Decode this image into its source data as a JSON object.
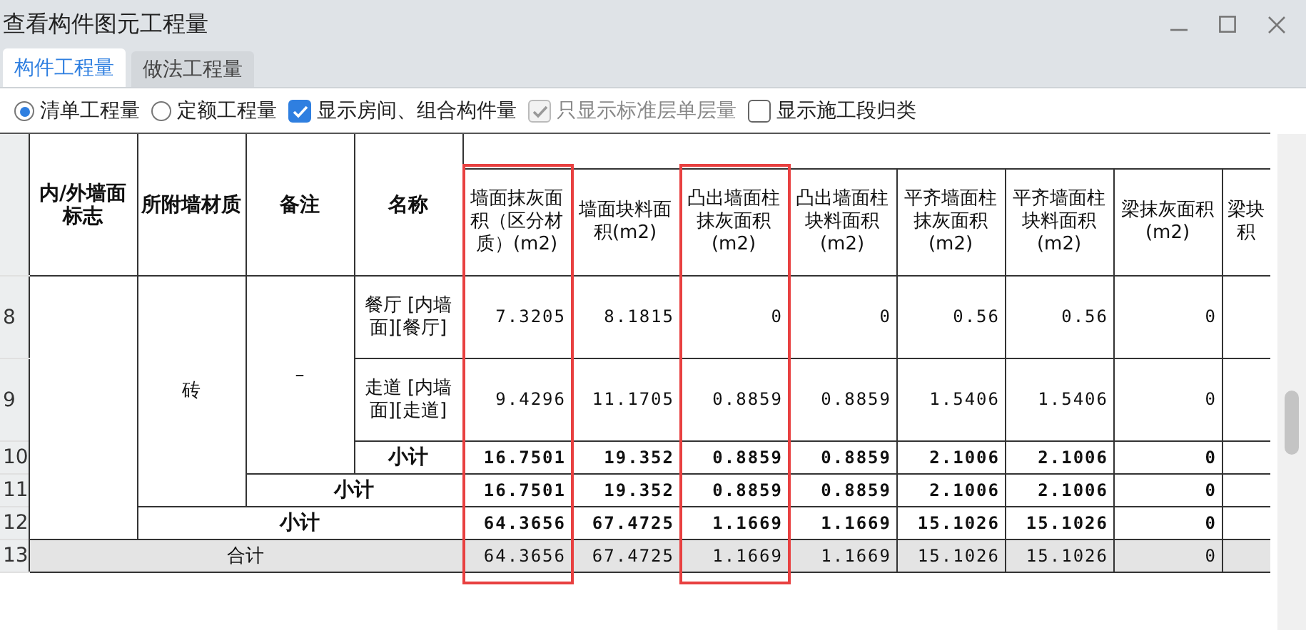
{
  "window": {
    "title": "查看构件图元工程量"
  },
  "tabs": [
    {
      "label": "构件工程量",
      "selected": true
    },
    {
      "label": "做法工程量",
      "selected": false
    }
  ],
  "options": [
    {
      "kind": "radio",
      "label": "清单工程量",
      "checked": true,
      "disabled": false
    },
    {
      "kind": "radio",
      "label": "定额工程量",
      "checked": false,
      "disabled": false
    },
    {
      "kind": "checkbox",
      "label": "显示房间、组合构件量",
      "checked": true,
      "disabled": false
    },
    {
      "kind": "checkbox",
      "label": "只显示标准层单层量",
      "checked": true,
      "disabled": true
    },
    {
      "kind": "checkbox",
      "label": "显示施工段归类",
      "checked": false,
      "disabled": false
    }
  ],
  "table": {
    "group_columns": [
      "内/外墙面标志",
      "所附墙材质",
      "备注",
      "名称"
    ],
    "quantity_columns": [
      {
        "label": "墙面抹灰面积（区分材质）(m2)",
        "highlighted": true
      },
      {
        "label": "墙面块料面积(m2)",
        "highlighted": false
      },
      {
        "label": "凸出墙面柱抹灰面积(m2)",
        "highlighted": true
      },
      {
        "label": "凸出墙面柱块料面积(m2)",
        "highlighted": false
      },
      {
        "label": "平齐墙面柱抹灰面积(m2)",
        "highlighted": false
      },
      {
        "label": "平齐墙面柱块料面积(m2)",
        "highlighted": false
      },
      {
        "label": "梁抹灰面积(m2)",
        "highlighted": false
      },
      {
        "label": "梁块积",
        "highlighted": false
      }
    ],
    "material": "砖",
    "remark": "–",
    "rows": [
      {
        "number": "8",
        "kind": "item",
        "name": "餐厅 [内墙面][餐厅]",
        "values": [
          "7.3205",
          "8.1815",
          "0",
          "0",
          "0.56",
          "0.56",
          "0"
        ]
      },
      {
        "number": "9",
        "kind": "item",
        "name": "走道 [内墙面][走道]",
        "values": [
          "9.4296",
          "11.1705",
          "0.8859",
          "0.8859",
          "1.5406",
          "1.5406",
          "0"
        ]
      },
      {
        "number": "10",
        "kind": "name_subtotal",
        "name": "小计",
        "values": [
          "16.7501",
          "19.352",
          "0.8859",
          "0.8859",
          "2.1006",
          "2.1006",
          "0"
        ]
      },
      {
        "number": "11",
        "kind": "remark_subtotal",
        "name": "小计",
        "values": [
          "16.7501",
          "19.352",
          "0.8859",
          "0.8859",
          "2.1006",
          "2.1006",
          "0"
        ]
      },
      {
        "number": "12",
        "kind": "material_subtotal",
        "name": "小计",
        "values": [
          "64.3656",
          "67.4725",
          "1.1669",
          "1.1669",
          "15.1026",
          "15.1026",
          "0"
        ]
      },
      {
        "number": "13",
        "kind": "total",
        "name": "合计",
        "values": [
          "64.3656",
          "67.4725",
          "1.1669",
          "1.1669",
          "15.1026",
          "15.1026",
          "0"
        ]
      }
    ]
  }
}
